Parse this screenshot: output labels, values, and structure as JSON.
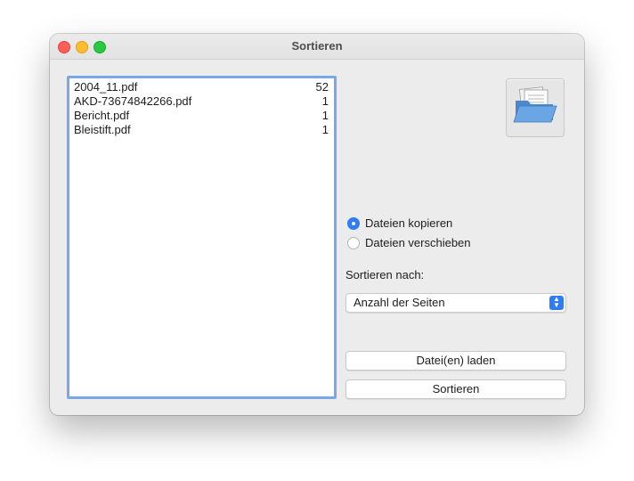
{
  "window": {
    "title": "Sortieren"
  },
  "files": [
    {
      "name": "2004_11.pdf",
      "pages": "52"
    },
    {
      "name": "AKD-73674842266.pdf",
      "pages": "1"
    },
    {
      "name": "Bericht.pdf",
      "pages": "1"
    },
    {
      "name": "Bleistift.pdf",
      "pages": "1"
    }
  ],
  "folder_button": {
    "icon": "folder-icon"
  },
  "mode": {
    "options": [
      {
        "label": "Dateien kopieren",
        "checked": true
      },
      {
        "label": "Dateien verschieben",
        "checked": false
      }
    ]
  },
  "sort": {
    "label": "Sortieren nach:",
    "selected": "Anzahl der Seiten"
  },
  "buttons": {
    "load": "Datei(en) laden",
    "sort": "Sortieren"
  },
  "colors": {
    "accent": "#2f7cf6",
    "list_focus": "#7aa7e6",
    "close": "#fe5f57",
    "minimize": "#febc2e",
    "maximize": "#28c840"
  }
}
